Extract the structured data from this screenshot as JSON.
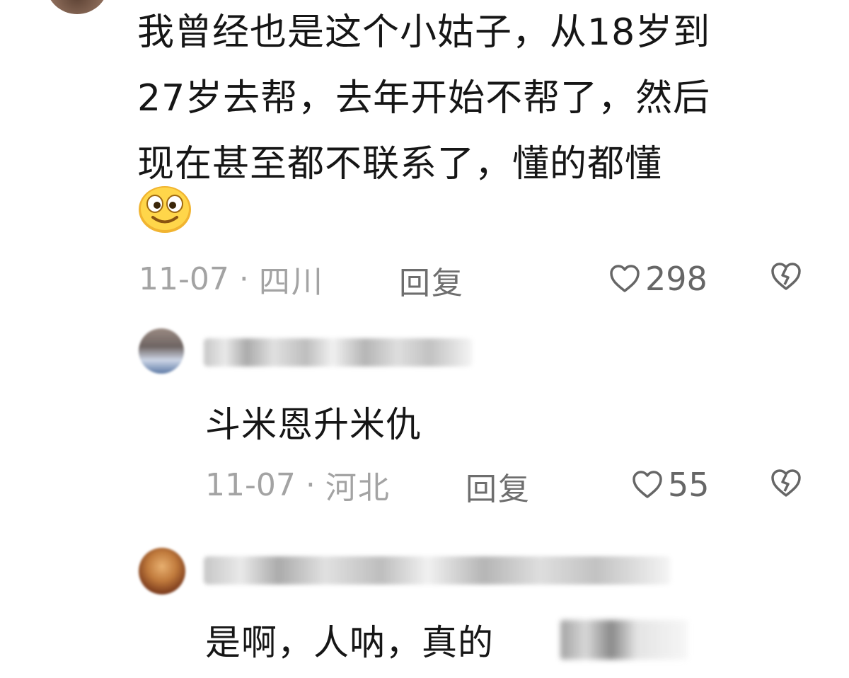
{
  "comments": [
    {
      "text": "我曾经也是这个小姑子，从18岁到\n27岁去帮，去年开始不帮了，然后\n现在甚至都不联系了，懂的都懂",
      "emoji": "smile-emoji",
      "date": "11-07",
      "location": "四川",
      "reply_label": "回复",
      "likes": "298"
    }
  ],
  "replies": [
    {
      "text": "斗米恩升米仇",
      "date": "11-07",
      "location": "河北",
      "reply_label": "回复",
      "likes": "55"
    },
    {
      "text": "是啊，人呐，真的"
    }
  ],
  "separator": "·",
  "colors": {
    "text": "#161616",
    "meta": "#a3a3a3",
    "icon": "#666666",
    "emoji_face": "#ffd64a"
  }
}
